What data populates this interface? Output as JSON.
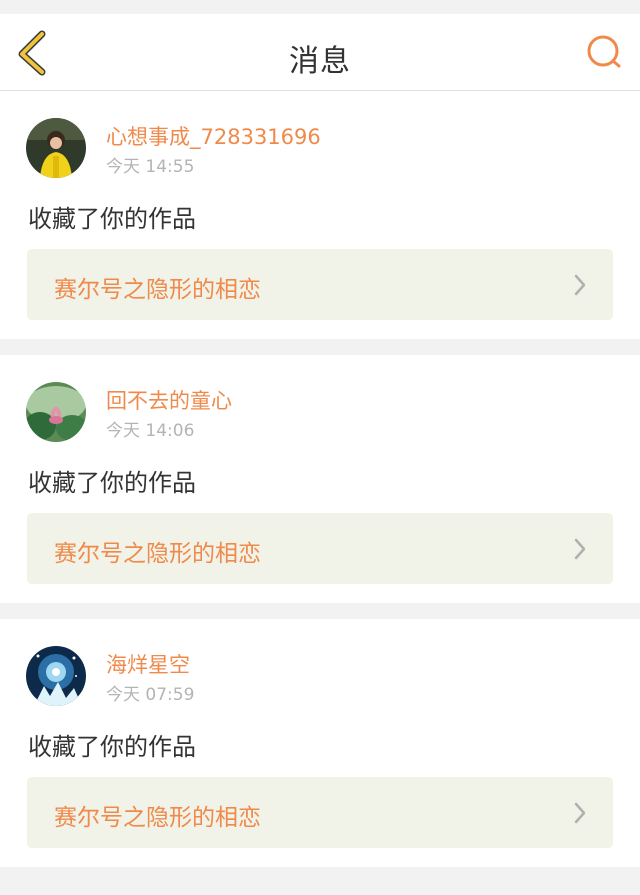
{
  "header": {
    "title": "消息",
    "accent_color": "#f0c43c",
    "search_color": "#f08a4b",
    "back_icon": "chevron-left-icon",
    "search_icon": "search-icon"
  },
  "messages": [
    {
      "username": "心想事成_728331696",
      "time": "今天 14:55",
      "action": "收藏了你的作品",
      "work_title": "赛尔号之隐形的相恋"
    },
    {
      "username": "回不去的童心",
      "time": "今天 14:06",
      "action": "收藏了你的作品",
      "work_title": "赛尔号之隐形的相恋"
    },
    {
      "username": "海烊星空",
      "time": "今天 07:59",
      "action": "收藏了你的作品",
      "work_title": "赛尔号之隐形的相恋"
    }
  ],
  "colors": {
    "username": "#f08a4b",
    "time": "#b4b4b4",
    "work_bg": "#f1f3e8"
  }
}
